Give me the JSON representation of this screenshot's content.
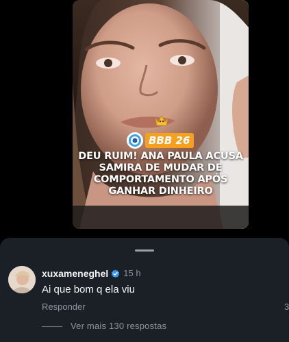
{
  "reel": {
    "badge": "BBB 26",
    "headline_lines": [
      "DEU RUIM! ANA PAULA ACUSA",
      "SAMIRA DE MUDAR DE",
      "COMPORTAMENTO APÓS",
      "GANHAR DINHEIRO"
    ]
  },
  "comment": {
    "username": "xuxameneghel",
    "time": "15 h",
    "text": "Ai que bom q ela viu",
    "reply_label": "Responder",
    "like_count": "3",
    "avatar_icon": "user-avatar",
    "verified_icon": "verified-badge-icon"
  },
  "replies": {
    "label": "Ver mais 130 respostas"
  },
  "colors": {
    "badge": "#f5a01e",
    "verified": "#3897f0",
    "sheet": "#1b2027"
  }
}
